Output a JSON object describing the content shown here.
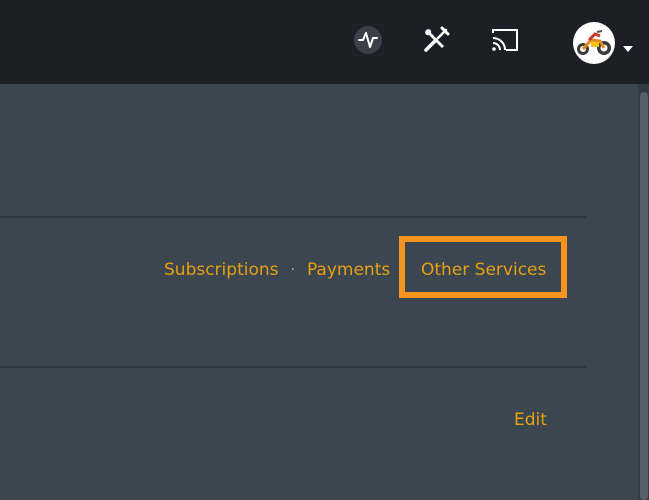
{
  "topbar": {
    "icons": {
      "activity": "activity-icon",
      "tools": "tools-icon",
      "cast": "cast-icon",
      "avatar": "avatar",
      "caret": "chevron-down-icon"
    }
  },
  "account_nav": {
    "subscriptions_label": "Subscriptions",
    "payments_label": "Payments",
    "separator": "·",
    "other_services_label": "Other Services"
  },
  "section": {
    "edit_label": "Edit"
  },
  "colors": {
    "accent": "#e5a00d",
    "highlight": "#f7941d",
    "topbar_bg": "#1c2026",
    "content_bg": "#3b4651"
  }
}
